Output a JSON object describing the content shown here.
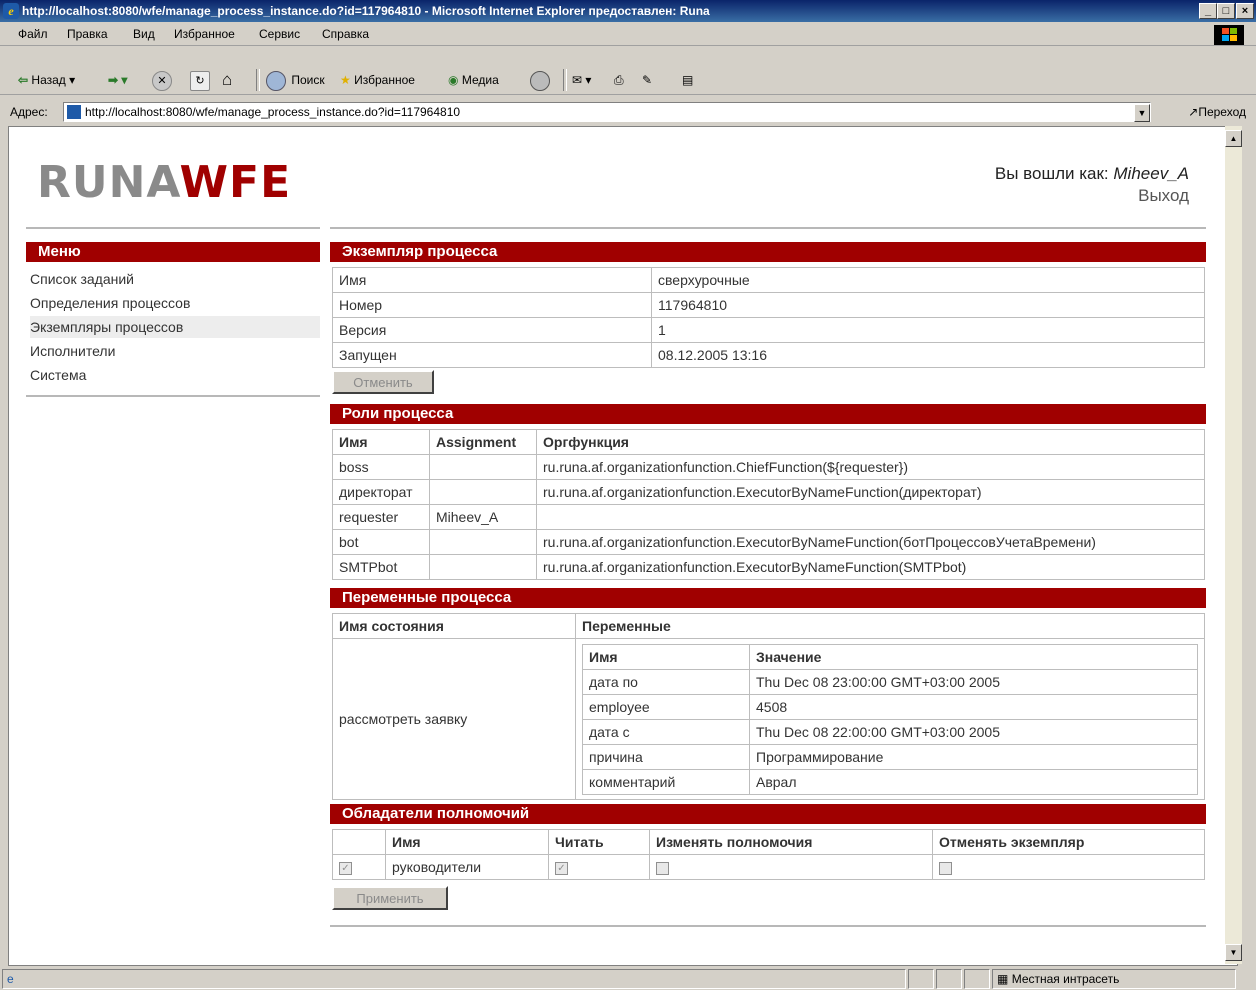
{
  "window": {
    "title": "http://localhost:8080/wfe/manage_process_instance.do?id=117964810 - Microsoft Internet Explorer предоставлен: Runa"
  },
  "menubar": [
    "Файл",
    "Правка",
    "Вид",
    "Избранное",
    "Сервис",
    "Справка"
  ],
  "toolbar": {
    "back": "Назад",
    "search": "Поиск",
    "favorites": "Избранное",
    "media": "Медиа"
  },
  "address": {
    "label": "Адрес:",
    "url": "http://localhost:8080/wfe/manage_process_instance.do?id=117964810",
    "go": "Переход"
  },
  "status": {
    "zone": "Местная интрасеть"
  },
  "page": {
    "logo_left": "RUNA",
    "logo_right": "WFE",
    "login_prefix": "Вы вошли как:",
    "login_user": "Miheev_A",
    "logout": "Выход"
  },
  "sidebar": {
    "header": "Меню",
    "items": [
      "Список заданий",
      "Определения процессов",
      "Экземпляры процессов",
      "Исполнители",
      "Система"
    ]
  },
  "instance": {
    "header": "Экземпляр процесса",
    "rows": [
      {
        "label": "Имя",
        "value": "сверхурочные"
      },
      {
        "label": "Номер",
        "value": "117964810"
      },
      {
        "label": "Версия",
        "value": "1"
      },
      {
        "label": "Запущен",
        "value": "08.12.2005 13:16"
      }
    ],
    "cancel_button": "Отменить"
  },
  "roles": {
    "header": "Роли процесса",
    "columns": [
      "Имя",
      "Assignment",
      "Оргфункция"
    ],
    "rows": [
      [
        "boss",
        "",
        "ru.runa.af.organizationfunction.ChiefFunction(${requester})"
      ],
      [
        "директорат",
        "",
        "ru.runa.af.organizationfunction.ExecutorByNameFunction(директорат)"
      ],
      [
        "requester",
        "Miheev_A",
        ""
      ],
      [
        "bot",
        "",
        "ru.runa.af.organizationfunction.ExecutorByNameFunction(ботПроцессовУчетаВремени)"
      ],
      [
        "SMTPbot",
        "",
        "ru.runa.af.organizationfunction.ExecutorByNameFunction(SMTPbot)"
      ]
    ]
  },
  "variables": {
    "header": "Переменные процесса",
    "columns": [
      "Имя состояния",
      "Переменные"
    ],
    "state": "рассмотреть заявку",
    "inner_columns": [
      "Имя",
      "Значение"
    ],
    "rows": [
      [
        "дата по",
        "Thu Dec 08 23:00:00 GMT+03:00 2005"
      ],
      [
        "employee",
        "4508"
      ],
      [
        "дата с",
        "Thu Dec 08 22:00:00 GMT+03:00 2005"
      ],
      [
        "причина",
        "Программирование"
      ],
      [
        "комментарий",
        "Аврал"
      ]
    ]
  },
  "permissions": {
    "header": "Обладатели полномочий",
    "columns": [
      "",
      "Имя",
      "Читать",
      "Изменять полномочия",
      "Отменять экземпляр"
    ],
    "rows": [
      {
        "name": "руководители",
        "selected": true,
        "read": true,
        "change": false,
        "cancel": false
      }
    ],
    "apply_button": "Применить"
  }
}
